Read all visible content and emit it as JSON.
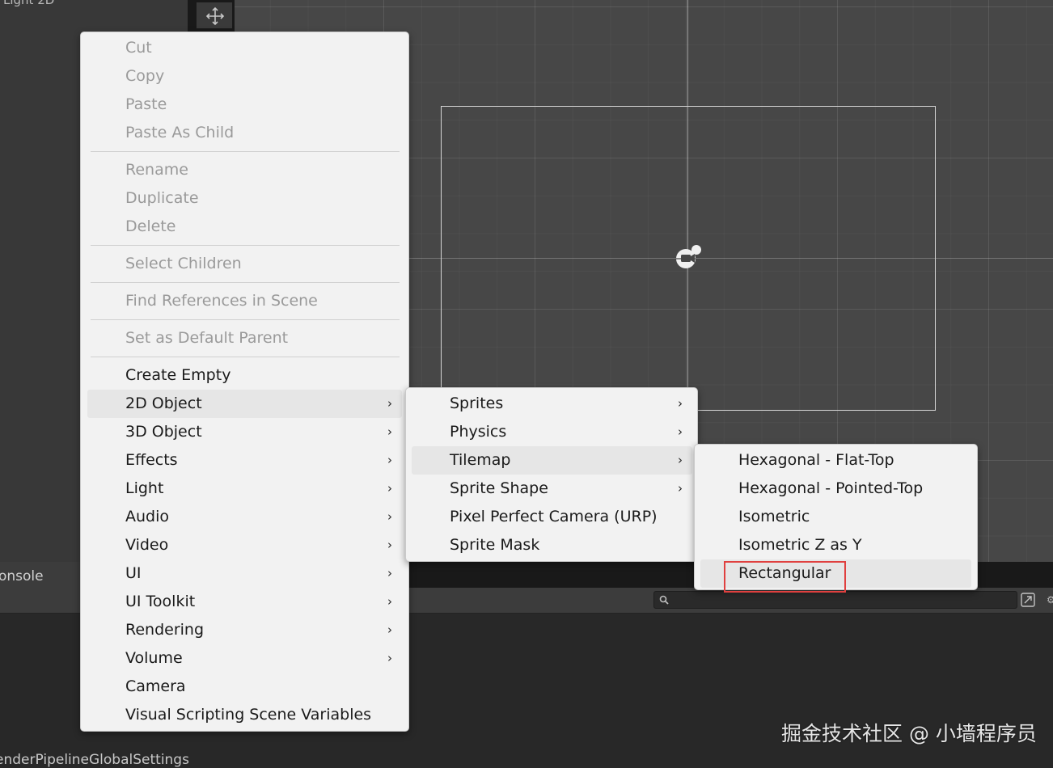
{
  "hierarchy": {
    "top_text": "Light 2D"
  },
  "console": {
    "tab_label": "onsole",
    "search_placeholder": "",
    "bottom_text": "enderPipelineGlobalSettings"
  },
  "watermark": "掘金技术社区 @ 小墙程序员",
  "icons": {
    "move_tool": "move-arrows-icon",
    "camera": "camera-gizmo-icon",
    "search": "search-icon",
    "expand": "expand-icon",
    "submenu_arrow": "›"
  },
  "colors": {
    "menu_bg": "#f2f2f2",
    "highlight": "#e6e6e6",
    "annotation_box": "#e0403f",
    "scene_bg": "#474747"
  },
  "context_menu": {
    "items": [
      {
        "label": "Cut",
        "disabled": true
      },
      {
        "label": "Copy",
        "disabled": true
      },
      {
        "label": "Paste",
        "disabled": true
      },
      {
        "label": "Paste As Child",
        "disabled": true
      },
      {
        "label": "Rename",
        "disabled": true
      },
      {
        "label": "Duplicate",
        "disabled": true
      },
      {
        "label": "Delete",
        "disabled": true
      },
      {
        "label": "Select Children",
        "disabled": true
      },
      {
        "label": "Find References in Scene",
        "disabled": true
      },
      {
        "label": "Set as Default Parent",
        "disabled": true
      },
      {
        "label": "Create Empty",
        "disabled": false
      },
      {
        "label": "2D Object",
        "submenu": true,
        "highlighted": true
      },
      {
        "label": "3D Object",
        "submenu": true
      },
      {
        "label": "Effects",
        "submenu": true
      },
      {
        "label": "Light",
        "submenu": true
      },
      {
        "label": "Audio",
        "submenu": true
      },
      {
        "label": "Video",
        "submenu": true
      },
      {
        "label": "UI",
        "submenu": true
      },
      {
        "label": "UI Toolkit",
        "submenu": true
      },
      {
        "label": "Rendering",
        "submenu": true
      },
      {
        "label": "Volume",
        "submenu": true
      },
      {
        "label": "Camera",
        "submenu": false
      },
      {
        "label": "Visual Scripting Scene Variables",
        "submenu": false
      }
    ]
  },
  "submenu_2d_object": {
    "items": [
      {
        "label": "Sprites",
        "submenu": true
      },
      {
        "label": "Physics",
        "submenu": true
      },
      {
        "label": "Tilemap",
        "submenu": true,
        "highlighted": true
      },
      {
        "label": "Sprite Shape",
        "submenu": true
      },
      {
        "label": "Pixel Perfect Camera (URP)",
        "submenu": false
      },
      {
        "label": "Sprite Mask",
        "submenu": false
      }
    ]
  },
  "submenu_tilemap": {
    "items": [
      {
        "label": "Hexagonal - Flat-Top"
      },
      {
        "label": "Hexagonal - Pointed-Top"
      },
      {
        "label": "Isometric"
      },
      {
        "label": "Isometric Z as Y"
      },
      {
        "label": "Rectangular",
        "highlighted": true,
        "annotated": true
      }
    ]
  }
}
